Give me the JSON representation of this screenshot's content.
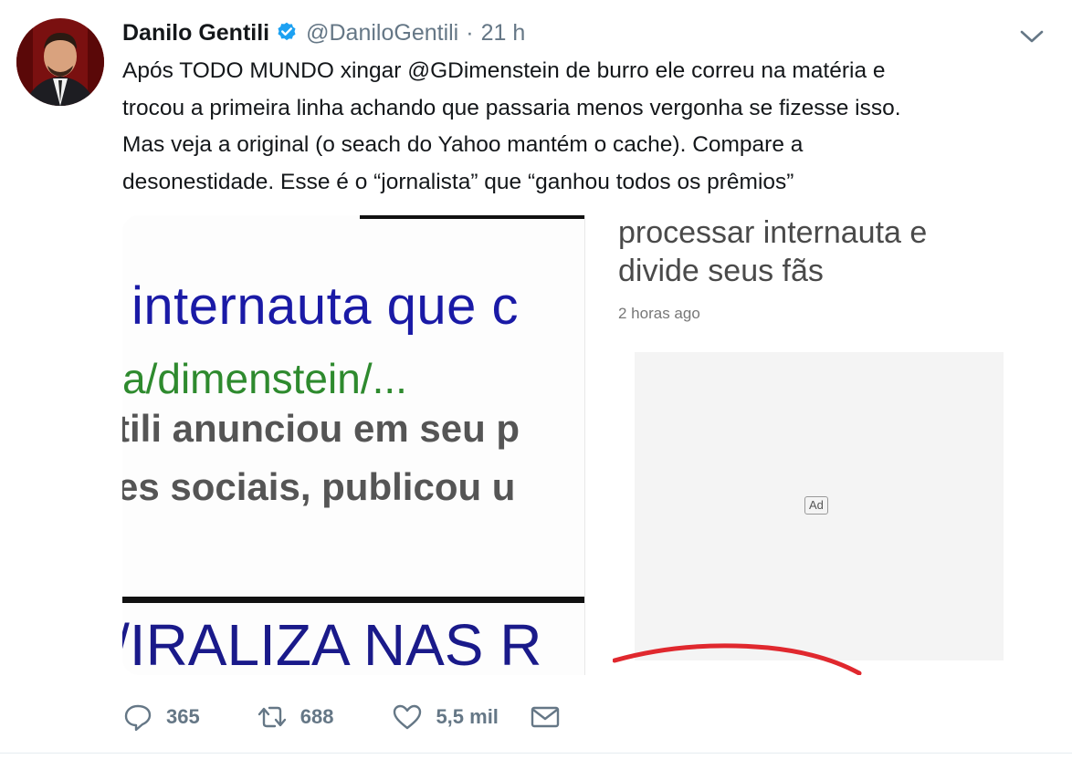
{
  "tweet": {
    "author": {
      "name": "Danilo Gentili",
      "handle": "@DaniloGentili",
      "separator": "·",
      "time": "21 h",
      "verified": true
    },
    "text_lines": [
      "Após TODO MUNDO xingar @GDimenstein de burro ele correu na matéria e",
      "trocou a primeira linha achando que passaria menos vergonha se fizesse isso.",
      "Mas veja a original (o seach do Yahoo mantém o cache). Compare a",
      "desonestidade. Esse é o “jornalista” que “ganhou todos os prêmios”"
    ],
    "media": {
      "left_image": {
        "line1": "internauta que c",
        "line2": "a/dimenstein/...",
        "line3": "tili anunciou em seu p",
        "line4": "es sociais, publicou u",
        "line5": "/IRALIZA NAS R"
      },
      "right_image": {
        "title_line1": "processar internauta e",
        "title_line2": "divide seus fãs",
        "timestamp": "2 horas ago",
        "ad_label": "Ad"
      }
    },
    "actions": {
      "replies": "365",
      "retweets": "688",
      "likes": "5,5 mil"
    },
    "colors": {
      "verified_blue": "#1da1f2",
      "meta_gray": "#657786",
      "scribble_red": "#e0282e"
    }
  }
}
